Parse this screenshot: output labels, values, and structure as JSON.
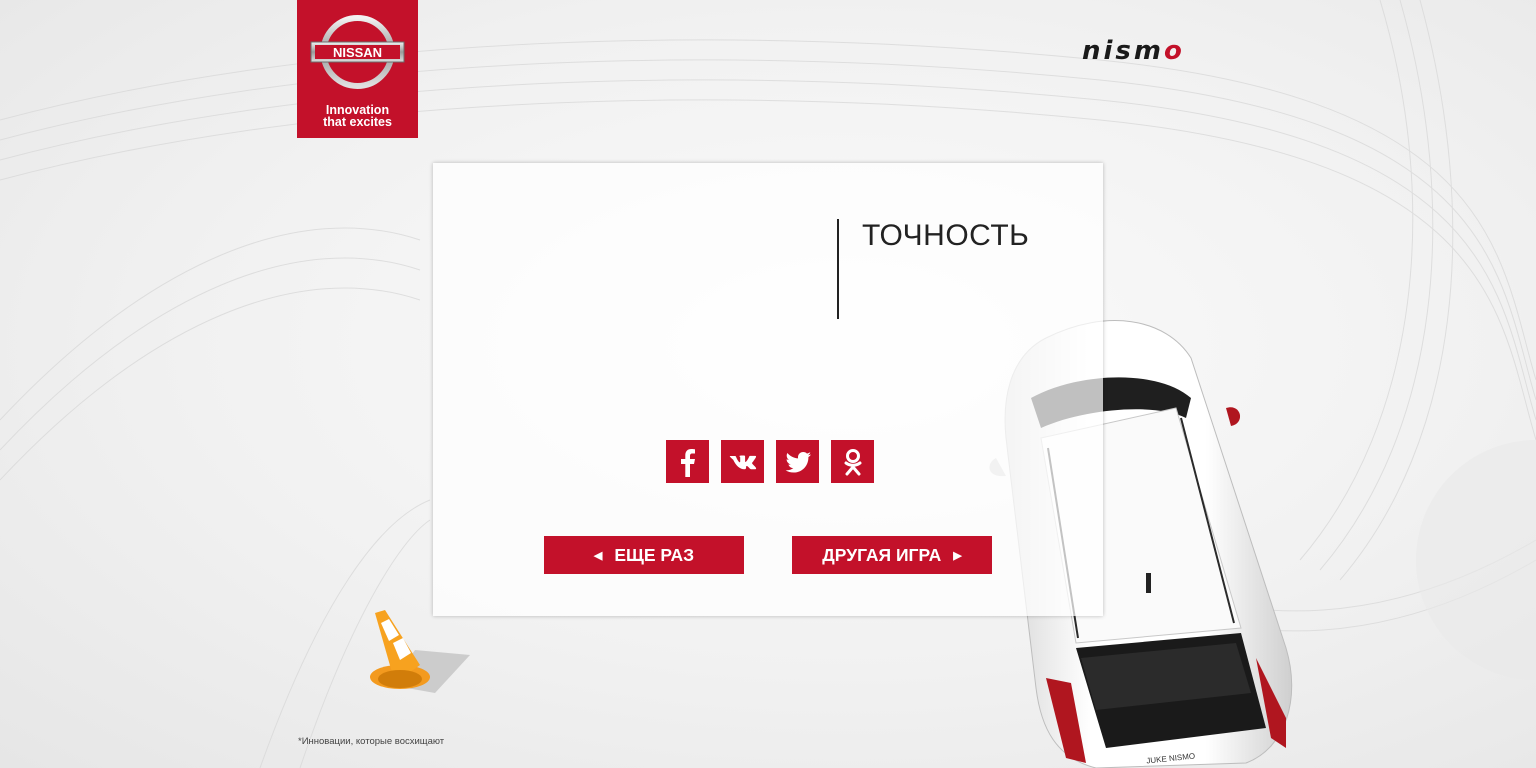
{
  "brand": {
    "logo_text": "NISSAN",
    "tagline": "Innovation\nthat excites",
    "sub_brand": "nismo"
  },
  "result": {
    "title": "ТОЧНОСТЬ"
  },
  "social": [
    {
      "name": "facebook-icon"
    },
    {
      "name": "vk-icon"
    },
    {
      "name": "twitter-icon"
    },
    {
      "name": "odnoklassniki-icon"
    }
  ],
  "buttons": {
    "again_label": "ЕЩЕ РАЗ",
    "other_game_label": "ДРУГАЯ ИГРА"
  },
  "car": {
    "plate_text": "JUKE NISMO"
  },
  "footnote": "*Инновации, которые восхищают",
  "colors": {
    "accent": "#c3112a",
    "text": "#222222"
  }
}
